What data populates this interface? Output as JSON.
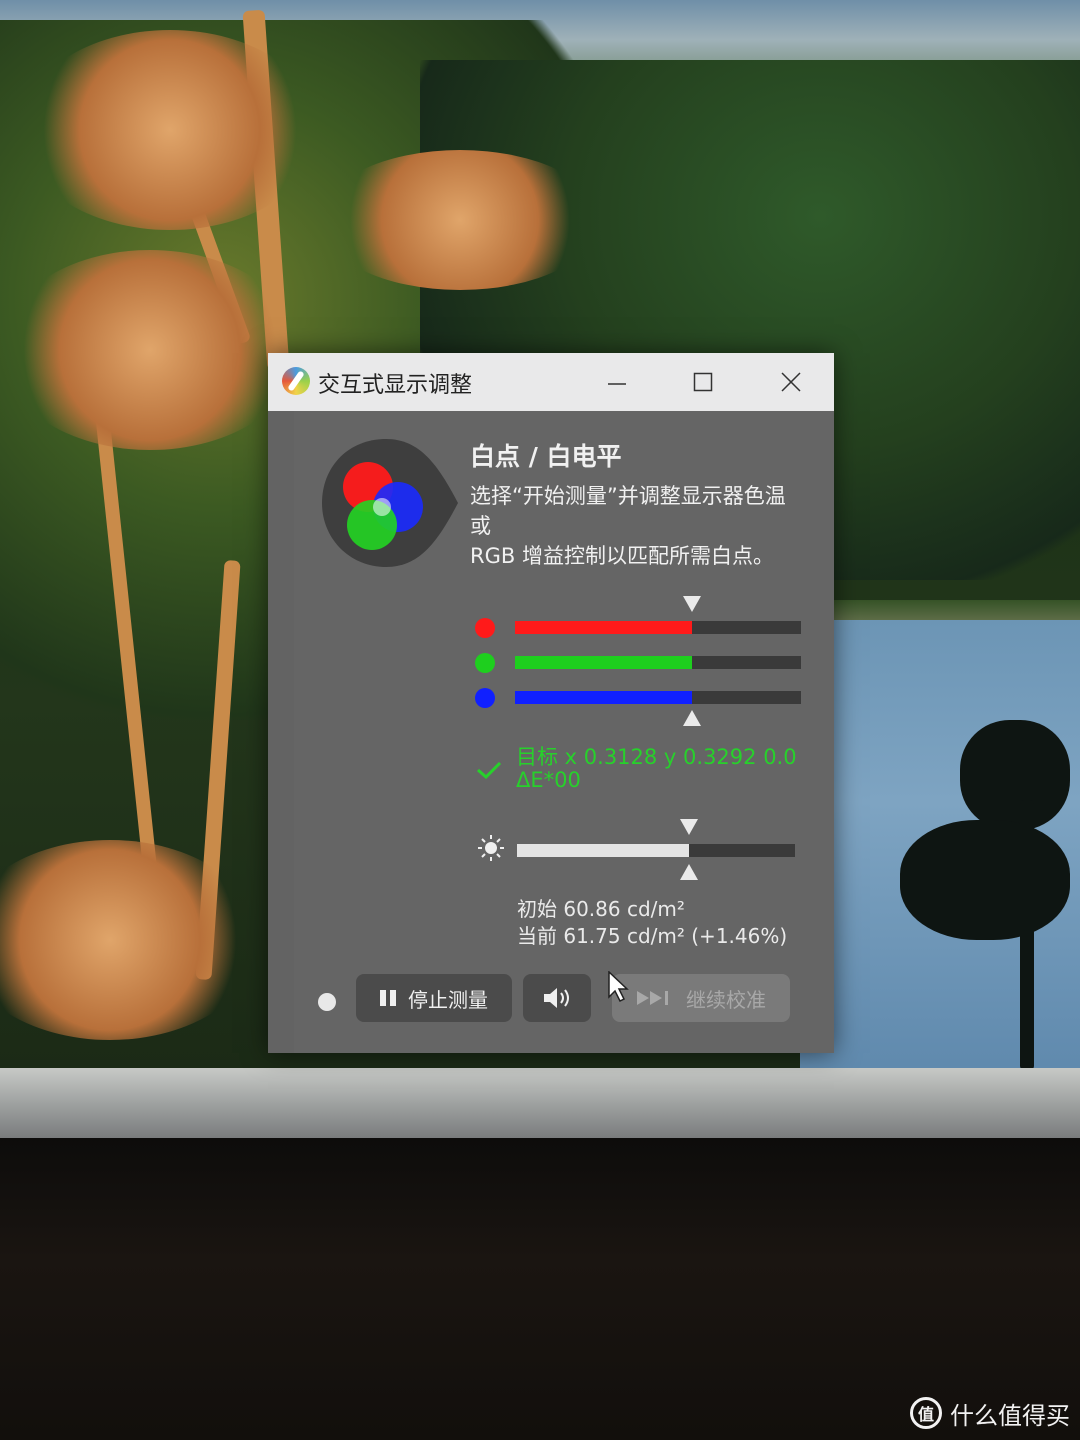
{
  "window": {
    "title": "交互式显示调整"
  },
  "panel": {
    "heading": "白点 / 白电平",
    "description_lines": [
      "选择“开始测量”并调整显示器色温",
      "或",
      "RGB 增益控制以匹配所需白点。"
    ]
  },
  "rgb_gain": {
    "red_level": 0.62,
    "green_level": 0.62,
    "blue_level": 0.62,
    "target_level": 0.62
  },
  "target": {
    "line1": "目标 x 0.3128 y 0.3292 0.0",
    "line2": "ΔE*00"
  },
  "luminance": {
    "level": 0.62,
    "initial": "初始 60.86 cd/m²",
    "current": "当前 61.75 cd/m² (+1.46%)"
  },
  "buttons": {
    "stop_label": "停止测量",
    "continue_label": "继续校准"
  },
  "watermark": {
    "text": "什么值得买",
    "icon_text": "值"
  },
  "colors": {
    "red": "#ff1a1a",
    "green": "#1ecf1e",
    "blue": "#1020ff",
    "ok_green": "#27d12b",
    "panel": "#656565"
  }
}
